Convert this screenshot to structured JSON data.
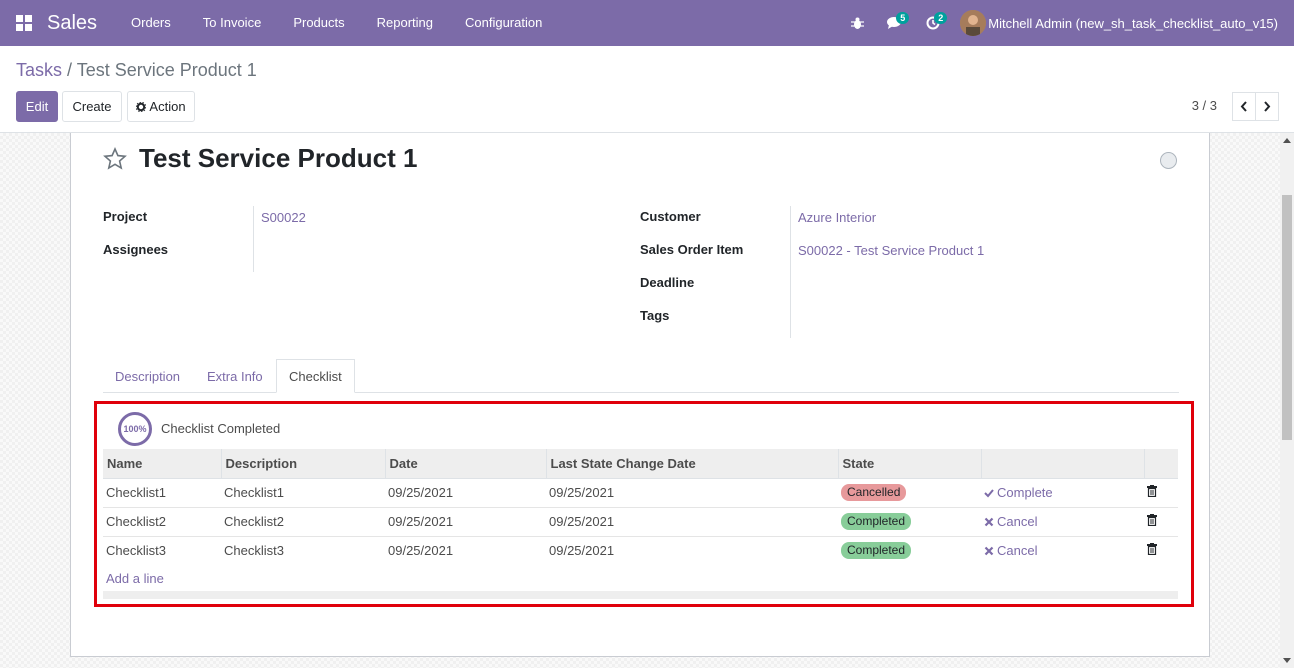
{
  "navbar": {
    "app_name": "Sales",
    "menu": [
      "Orders",
      "To Invoice",
      "Products",
      "Reporting",
      "Configuration"
    ],
    "messages_count": "5",
    "activities_count": "2",
    "user_name": "Mitchell Admin (new_sh_task_checklist_auto_v15)",
    "color": "#7c6ba8"
  },
  "breadcrumb": {
    "parent": "Tasks",
    "separator": "/",
    "current": "Test Service Product 1"
  },
  "toolbar": {
    "edit_label": "Edit",
    "create_label": "Create",
    "action_label": "Action",
    "pager": "3 / 3"
  },
  "record": {
    "title": "Test Service Product 1",
    "fields_left": [
      {
        "label": "Project",
        "value": "S00022"
      },
      {
        "label": "Assignees",
        "value": ""
      }
    ],
    "fields_right": [
      {
        "label": "Customer",
        "value": "Azure Interior"
      },
      {
        "label": "Sales Order Item",
        "value": "S00022 - Test Service Product 1"
      },
      {
        "label": "Deadline",
        "value": ""
      },
      {
        "label": "Tags",
        "value": ""
      }
    ]
  },
  "tabs": [
    "Description",
    "Extra Info",
    "Checklist"
  ],
  "active_tab": "Checklist",
  "checklist": {
    "progress_percent": 100,
    "progress_text": "100%",
    "status_label": "Checklist Completed",
    "columns": [
      "Name",
      "Description",
      "Date",
      "Last State Change Date",
      "State"
    ],
    "rows": [
      {
        "name": "Checklist1",
        "description": "Checklist1",
        "date": "09/25/2021",
        "last_change": "09/25/2021",
        "state": "Cancelled",
        "action": "Complete"
      },
      {
        "name": "Checklist2",
        "description": "Checklist2",
        "date": "09/25/2021",
        "last_change": "09/25/2021",
        "state": "Completed",
        "action": "Cancel"
      },
      {
        "name": "Checklist3",
        "description": "Checklist3",
        "date": "09/25/2021",
        "last_change": "09/25/2021",
        "state": "Completed",
        "action": "Cancel"
      }
    ],
    "add_line_label": "Add a line"
  },
  "colors": {
    "accent": "#7c6ba8",
    "highlight": "#e0000b",
    "cancelled": "#e7999b",
    "completed": "#88cd99"
  }
}
